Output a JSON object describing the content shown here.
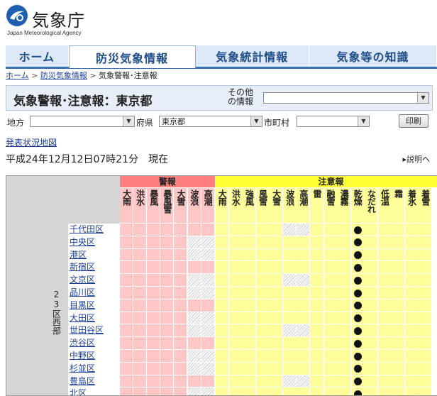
{
  "header": {
    "logo_text": "気象庁",
    "logo_sub": "Japan Meteorological Agency"
  },
  "nav": {
    "tabs": [
      "ホーム",
      "防災気象情報",
      "気象統計情報",
      "気象等の知識"
    ],
    "active_index": 1
  },
  "breadcrumb": {
    "items": [
      "ホーム",
      "防災気象情報",
      "気象警報･注意報"
    ],
    "separator": ">"
  },
  "page": {
    "title": "気象警報･注意報：東京都",
    "other_info_label_1": "その他",
    "other_info_label_2": "の情報",
    "other_info_value": ""
  },
  "filters": {
    "region_label": "地方",
    "region_value": "",
    "pref_label": "府県",
    "pref_value": "東京都",
    "city_label": "市町村",
    "city_value": "",
    "print_label": "印刷"
  },
  "links": {
    "map_link": "発表状況地図",
    "explain_link": "説明へ"
  },
  "status": {
    "issued_at": "平成24年12月12日07時21分　現在"
  },
  "table": {
    "warnings_header": "警報",
    "advisories_header": "注意報",
    "warning_columns": [
      "大雨",
      "洪水",
      "暴風",
      "暴風雪",
      "大雪",
      "波浪",
      "高潮"
    ],
    "advisory_columns": [
      "大雨",
      "洪水",
      "強風",
      "風雪",
      "大雪",
      "波浪",
      "高潮",
      "雷",
      "融雪",
      "濃霧",
      "乾燥",
      "なだれ",
      "低温",
      "霜",
      "着氷",
      "着雪"
    ],
    "region_label": "23区西部",
    "rows": [
      "千代田区",
      "中央区",
      "港区",
      "新宿区",
      "文京区",
      "品川区",
      "目黒区",
      "大田区",
      "世田谷区",
      "渋谷区",
      "中野区",
      "杉並区",
      "豊島区",
      "北区"
    ],
    "hatched_warning_cols": [
      5,
      6
    ],
    "hatched_advisory_cols": [
      5,
      6
    ],
    "active_advisory": "乾燥",
    "colors": {
      "warning_header": "#ff7f7f",
      "warning_cell": "#ffc6c6",
      "advisory_header": "#ffff33",
      "advisory_cell": "#ffff9a"
    }
  }
}
